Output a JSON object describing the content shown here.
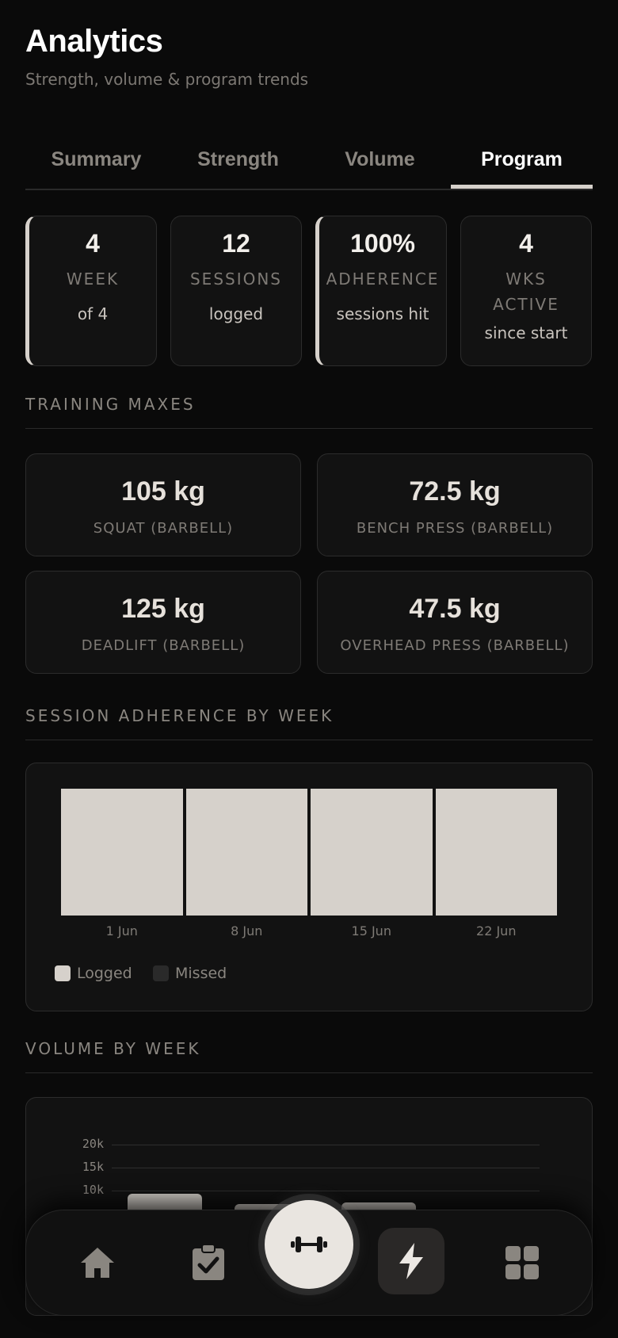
{
  "header": {
    "title": "Analytics",
    "subtitle": "Strength, volume & program trends"
  },
  "tabs": [
    {
      "label": "Summary",
      "active": false
    },
    {
      "label": "Strength",
      "active": false
    },
    {
      "label": "Volume",
      "active": false
    },
    {
      "label": "Program",
      "active": true
    }
  ],
  "stats": [
    {
      "value": "4",
      "label": "WEEK",
      "sub": "of 4",
      "accent": true
    },
    {
      "value": "12",
      "label": "SESSIONS",
      "sub": "logged",
      "accent": false
    },
    {
      "value": "100%",
      "label": "ADHERENCE",
      "sub": "sessions hit",
      "accent": true
    },
    {
      "value": "4",
      "label": "WKS ACTIVE",
      "sub": "since start",
      "accent": false
    }
  ],
  "training_maxes": {
    "heading": "TRAINING MAXES",
    "items": [
      {
        "value": "105 kg",
        "label": "SQUAT (BARBELL)"
      },
      {
        "value": "72.5 kg",
        "label": "BENCH PRESS (BARBELL)"
      },
      {
        "value": "125 kg",
        "label": "DEADLIFT (BARBELL)"
      },
      {
        "value": "47.5 kg",
        "label": "OVERHEAD PRESS (BARBELL)"
      }
    ]
  },
  "adherence": {
    "heading": "SESSION ADHERENCE BY WEEK",
    "legend": {
      "logged": "Logged",
      "missed": "Missed"
    }
  },
  "volume": {
    "heading": "VOLUME BY WEEK"
  },
  "chart_data": [
    {
      "type": "bar",
      "categories": [
        "1 Jun",
        "8 Jun",
        "15 Jun",
        "22 Jun"
      ],
      "series": [
        {
          "name": "Logged",
          "values": [
            1,
            1,
            1,
            1
          ]
        },
        {
          "name": "Missed",
          "values": [
            0,
            0,
            0,
            0
          ]
        }
      ],
      "stacked": true,
      "ylim": [
        0,
        1
      ],
      "legend": "bottom-left",
      "colors": {
        "Logged": "#d6d1cb",
        "Missed": "#2a2a2a"
      }
    },
    {
      "type": "bar",
      "categories": [],
      "values": [
        9300,
        7000,
        7400
      ],
      "yticks": [
        "10k",
        "15k",
        "20k"
      ],
      "ylim": [
        0,
        20000
      ],
      "grid": true,
      "color": "#d6d1cb"
    }
  ],
  "nav": {
    "items": [
      "home-icon",
      "clipboard-check-icon",
      "dumbbell-icon",
      "bolt-icon",
      "grid-icon"
    ],
    "active": "bolt-icon"
  },
  "colors": {
    "background": "#0a0a0a",
    "card": "#121212",
    "border": "#2c2c2c",
    "accent": "#d6d1cb"
  }
}
